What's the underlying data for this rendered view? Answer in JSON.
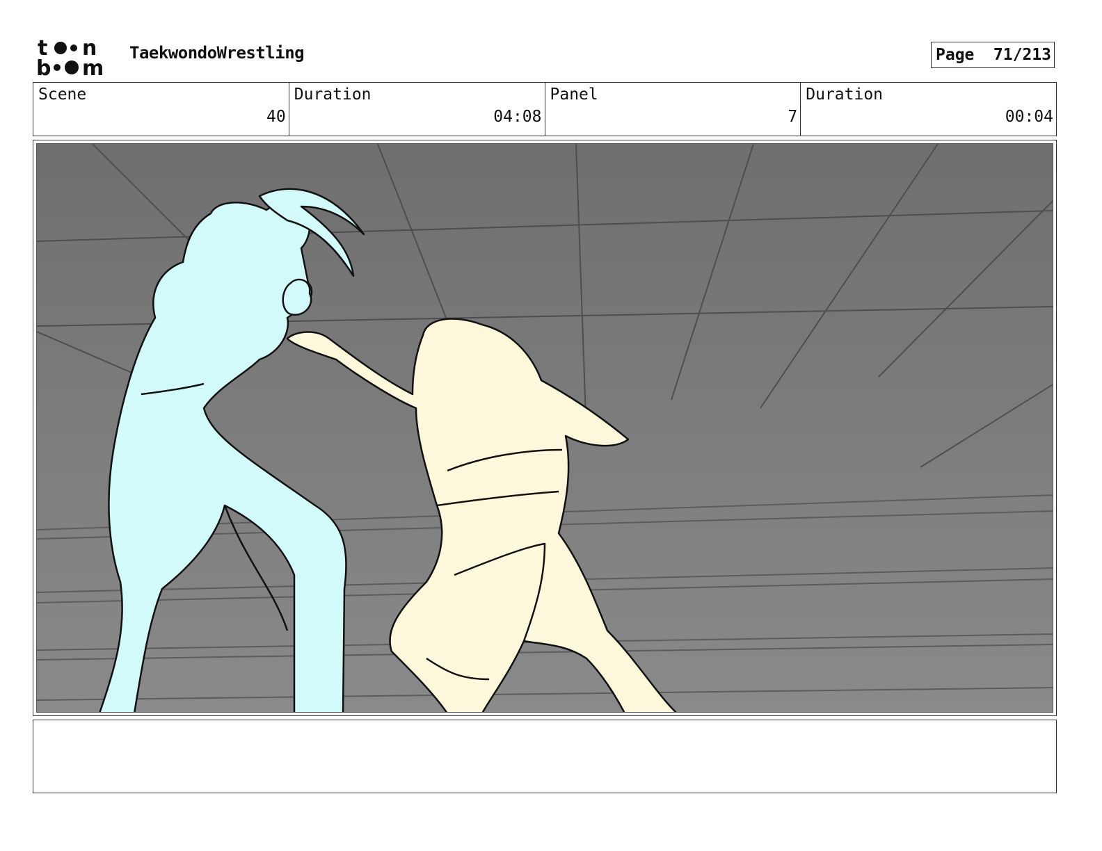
{
  "header": {
    "logo_icon": "toon-boom-logo-icon",
    "project_title": "TaekwondoWrestling",
    "page_label": "Page",
    "page_number": "71/213"
  },
  "info": {
    "scene_label": "Scene",
    "scene_value": "40",
    "scene_duration_label": "Duration",
    "scene_duration_value": "04:08",
    "panel_label": "Panel",
    "panel_value": "7",
    "panel_duration_label": "Duration",
    "panel_duration_value": "00:04"
  },
  "panel": {
    "colors": {
      "background": "#7a7a7a",
      "fighter_left": "#d2fafa",
      "fighter_right": "#fdf8dc",
      "lines": "#111111"
    }
  },
  "notes": {
    "text": ""
  }
}
